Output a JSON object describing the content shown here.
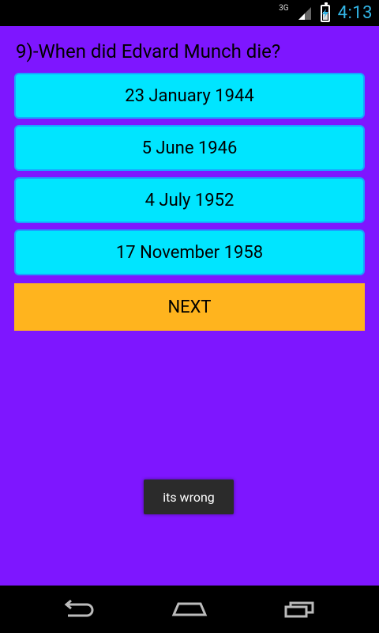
{
  "status_bar": {
    "network": "3G",
    "time": "4:13",
    "icons": {
      "signal": "signal-icon",
      "battery": "battery-charging-icon"
    }
  },
  "quiz": {
    "question": "9)-When did Edvard Munch die?",
    "options": [
      "23 January 1944",
      "5 June 1946",
      "4 July 1952",
      "17 November 1958"
    ],
    "next_label": "NEXT"
  },
  "toast": {
    "text": "its wrong"
  },
  "navigation": {
    "back_icon": "back-icon",
    "home_icon": "home-icon",
    "recent_icon": "recent-apps-icon"
  },
  "colors": {
    "background": "#7e16ff",
    "answer_fill": "#00e5ff",
    "answer_border": "#1aa1ff",
    "next_fill": "#ffb41e",
    "clock": "#33b5e5"
  }
}
